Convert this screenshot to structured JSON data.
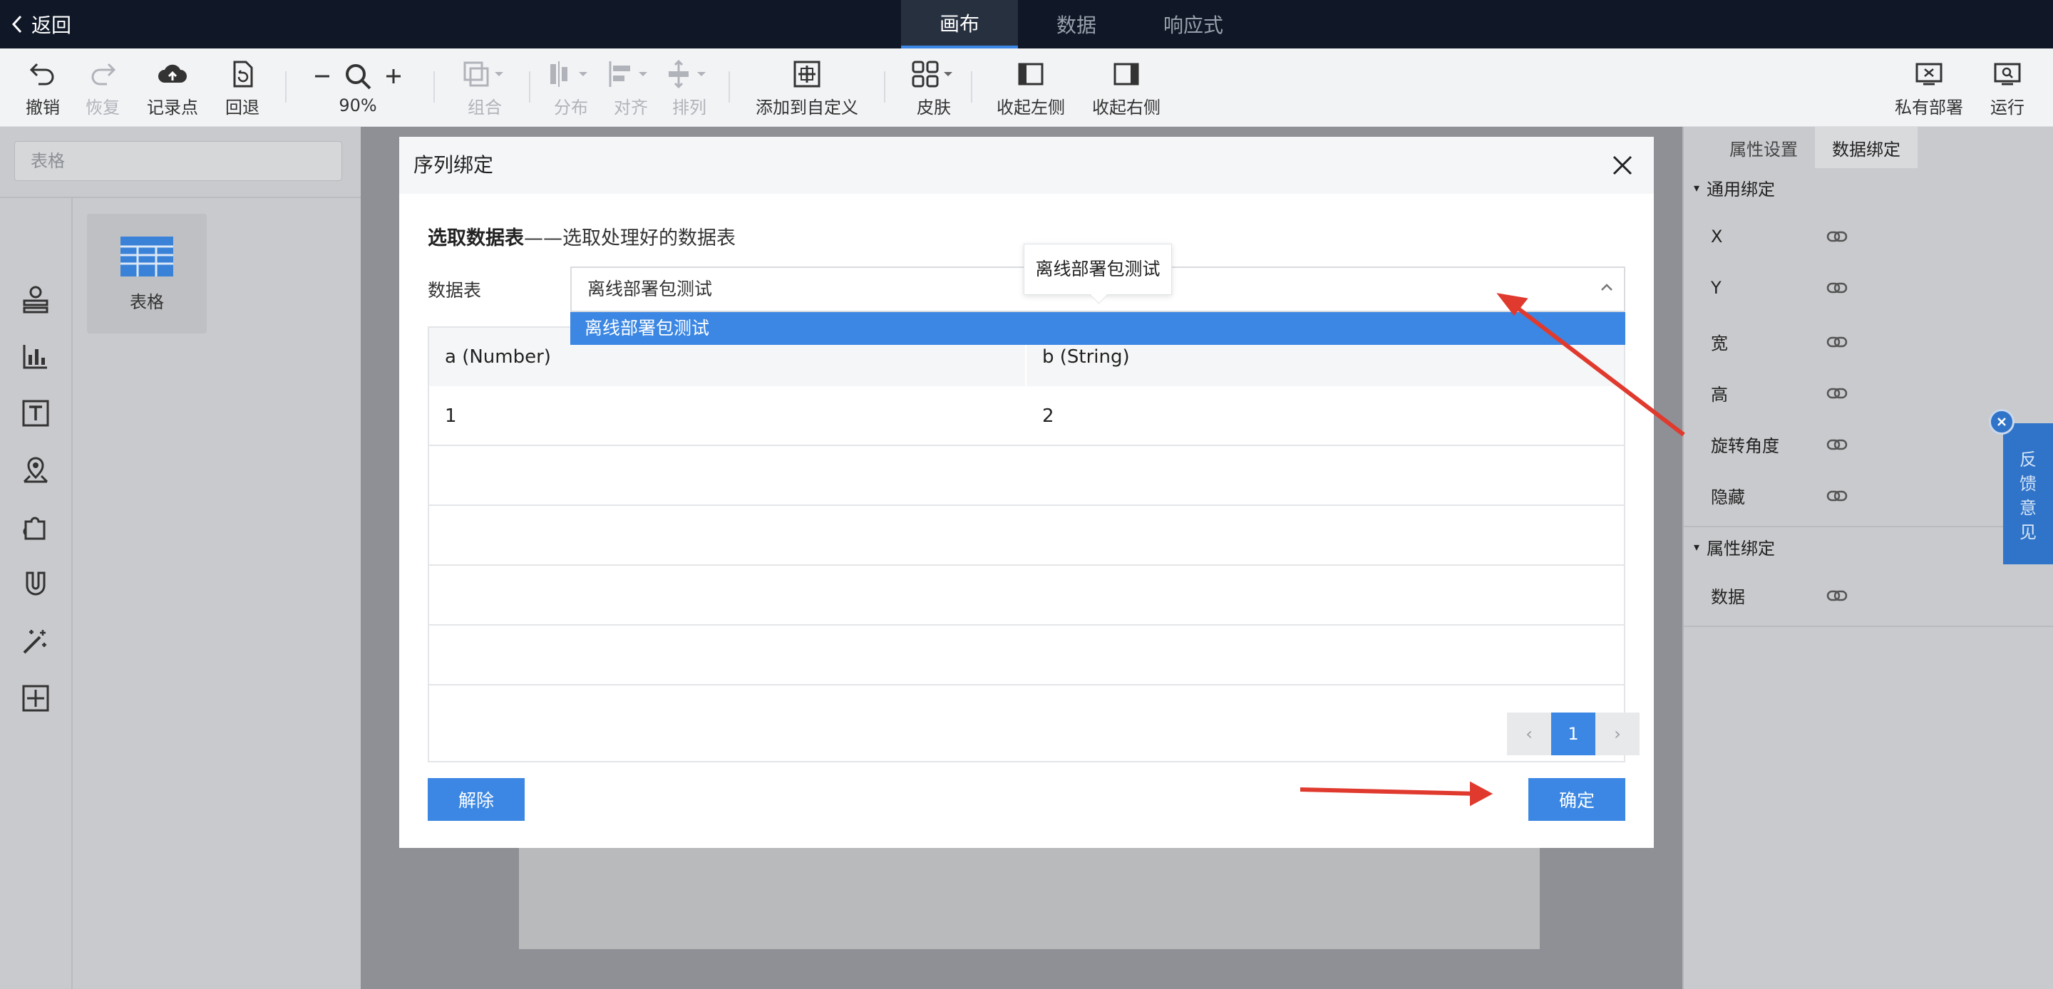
{
  "topnav": {
    "back_label": "返回",
    "tabs": [
      {
        "label": "画布",
        "active": true
      },
      {
        "label": "数据",
        "active": false
      },
      {
        "label": "响应式",
        "active": false
      }
    ]
  },
  "toolbar": {
    "undo": "撤销",
    "redo": "恢复",
    "record": "记录点",
    "rollback": "回退",
    "zoom": "90%",
    "group": "组合",
    "distribute": "分布",
    "align": "对齐",
    "arrange": "排列",
    "add_custom": "添加到自定义",
    "skin": "皮肤",
    "collapse_left": "收起左侧",
    "collapse_right": "收起右侧",
    "private_deploy": "私有部署",
    "run": "运行"
  },
  "leftpanel": {
    "search_placeholder": "表格",
    "component_label": "表格"
  },
  "rightpanel": {
    "tabs": [
      {
        "label": "属性设置",
        "active": false
      },
      {
        "label": "数据绑定",
        "active": true
      }
    ],
    "general_section": "通用绑定",
    "general_items": [
      "X",
      "Y",
      "宽",
      "高",
      "旋转角度",
      "隐藏"
    ],
    "attr_section": "属性绑定",
    "attr_items": [
      "数据"
    ]
  },
  "feedback": {
    "label": "反馈意见"
  },
  "modal": {
    "title": "序列绑定",
    "subtitle_bold": "选取数据表",
    "subtitle_rest": "——选取处理好的数据表",
    "field_label": "数据表",
    "selected_value": "离线部署包测试",
    "tooltip": "离线部署包测试",
    "option": "离线部署包测试",
    "columns": [
      "a (Number)",
      "b (String)"
    ],
    "rows": [
      [
        "1",
        "2"
      ]
    ],
    "current_page": "1",
    "prev": "‹",
    "next": "›",
    "unbind_label": "解除",
    "confirm_label": "确定"
  },
  "colors": {
    "accent": "#3b87e3",
    "annotation_arrow": "#e03a2e",
    "nav_bg": "#101726"
  }
}
